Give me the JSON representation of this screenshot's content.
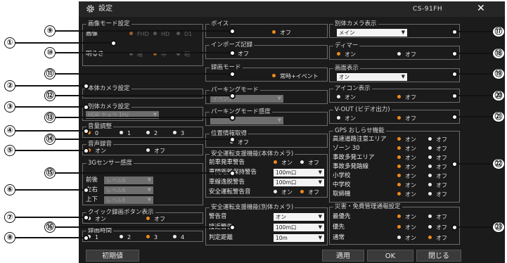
{
  "window": {
    "title": "設定",
    "model": "CS-91FH",
    "close_glyph": "✕",
    "buttons": {
      "reset": "初期値",
      "apply": "適用",
      "ok": "OK",
      "close": "閉じる"
    }
  },
  "callouts": {
    "n1": "①",
    "n2": "②",
    "n3": "③",
    "n4": "④",
    "n5": "⑤",
    "n6": "⑥",
    "n7": "⑦",
    "n8": "⑧",
    "n9": "⑨",
    "n10": "⑩",
    "n11": "⑪",
    "n12": "⑫",
    "n13": "⑬",
    "n14": "⑭",
    "n15": "⑮",
    "n16": "⑯",
    "n17": "⑰",
    "n18": "⑱",
    "n19": "⑲",
    "n20": "⑳",
    "n21": "㉑",
    "n22": "㉒",
    "n23": "㉓"
  },
  "col1": {
    "image_mode": {
      "title": "画像モード設定",
      "row1_label": "画像",
      "row1_options": [
        "FHD",
        "HD",
        "D1"
      ],
      "row2_label": "明るさ",
      "row2_options": [
        "暗",
        "中",
        "明"
      ]
    },
    "main_camera": {
      "title": "本体カメラ設定"
    },
    "sub_camera": {
      "title": "別体カメラ設定",
      "value": "HDR カメラ 1Hz"
    },
    "volume": {
      "title": "音量調整",
      "options": [
        "0",
        "1",
        "2",
        "3"
      ]
    },
    "voice_rec": {
      "title": "音声録音",
      "on": "オン",
      "off": "オフ"
    },
    "g_sensor": {
      "title": "3Gセンサー感度",
      "rows": [
        {
          "label": "前後",
          "value": "レベル6"
        },
        {
          "label": "左右",
          "value": "レベル6"
        },
        {
          "label": "上下",
          "value": "レベル6"
        }
      ]
    },
    "quick_rec": {
      "title": "クイック録画ボタン表示",
      "on": "オン",
      "off": "オフ"
    },
    "rec_time": {
      "title": "録画時間",
      "options": [
        "1",
        "2",
        "3",
        "4"
      ]
    }
  },
  "col2": {
    "voice": {
      "title": "ボイス",
      "off": "オフ"
    },
    "impose": {
      "title": "インポーズ記録",
      "off": "オフ"
    },
    "rec_mode": {
      "title": "録画モード",
      "value": "常時+イベント"
    },
    "parking_mode": {
      "title": "パーキングモード",
      "value": "イベント"
    },
    "parking_sens": {
      "title": "パーキングモード感度",
      "value": ""
    },
    "gps": {
      "title": "位置情報取得",
      "off": "オフ"
    },
    "main_assist": {
      "title": "安全運転支援機能(本体カメラ)",
      "rows": [
        {
          "label": "前車発車警告",
          "on": "オン",
          "off": "オフ"
        },
        {
          "label": "車間距離保持警告",
          "value": "100ｍ口"
        },
        {
          "label": "車線逸脱警告",
          "value": "100ｍ口"
        },
        {
          "label": "安全運転警告音",
          "on": "オン",
          "off": "オフ"
        }
      ]
    },
    "sub_assist": {
      "title": "安全運転支援機能(別体カメラ)",
      "rows": [
        {
          "label": "警告音",
          "value": "オン"
        },
        {
          "label": "接近警告",
          "value": "100ｍ口"
        },
        {
          "label": "判定距離",
          "value": "10m"
        }
      ]
    }
  },
  "col3": {
    "sub_display": {
      "title": "別体カメラ表示",
      "value": "メイン"
    },
    "dimmer": {
      "title": "ディマー",
      "on": "オン",
      "off": "オフ"
    },
    "screen": {
      "title": "画面表示",
      "value": "オン"
    },
    "icon": {
      "title": "アイコン表示",
      "on": "オン",
      "off": "オフ"
    },
    "vout": {
      "title": "V-OUT (ビデオ出力)",
      "on": "オン",
      "off": "オフ"
    },
    "gps_alert": {
      "title": "GPS おしらせ機能",
      "on": "オン",
      "off": "オフ",
      "rows": [
        "高速道路注意エリア",
        "ゾーン 30",
        "事故多発エリア",
        "事故多発踏線",
        "小学校",
        "中学校",
        "取締機"
      ]
    },
    "disaster": {
      "title": "災害・免費管理通報設定",
      "on": "オン",
      "off": "オフ",
      "rows": [
        "最優先",
        "優先",
        "通常"
      ]
    }
  }
}
